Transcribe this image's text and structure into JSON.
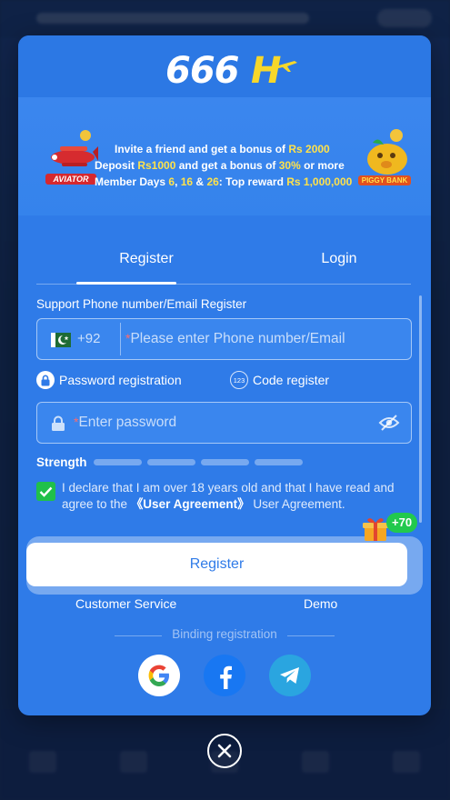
{
  "brand": {
    "logo_text": "666",
    "logo_letter": "H"
  },
  "promo": {
    "line1": {
      "text": "Invite a friend and get a bonus of ",
      "highlight": "Rs 2000"
    },
    "line2": {
      "pre": "Deposit ",
      "amount": "Rs1000",
      "mid": " and get a bonus of ",
      "percent": "30%",
      "post": " or more"
    },
    "line3": {
      "pre": "Member Days ",
      "d1": "6",
      "sep1": ", ",
      "d2": "16",
      "sep2": " & ",
      "d3": "26",
      "mid": ": Top reward ",
      "reward": "Rs 1,000,000"
    },
    "left_badge": "AVIATOR",
    "right_badge": "PIGGY BANK"
  },
  "tabs": {
    "register": "Register",
    "login": "Login",
    "active": "register"
  },
  "form": {
    "section_label": "Support Phone number/Email Register",
    "country_code": "+92",
    "phone_placeholder": "Please enter Phone number/Email",
    "password_placeholder": "Enter password",
    "required_mark": "*",
    "mode_password": "Password registration",
    "mode_code": "Code register",
    "code_icon_text": "123",
    "strength_label": "Strength",
    "strength_bars": 4,
    "strength_level": 0,
    "agree_text_1": "I declare that I am over 18 years old and that I have read and agree to the ",
    "agree_link": "《User Agreement》",
    "agree_text_2": " User Agreement.",
    "agree_checked": true,
    "register_button": "Register",
    "bonus_badge": "+70"
  },
  "links": {
    "customer_service": "Customer Service",
    "demo": "Demo"
  },
  "binding": {
    "label": "Binding registration",
    "providers": [
      "google",
      "facebook",
      "telegram"
    ]
  },
  "colors": {
    "modal_bg": "#2f7be8",
    "highlight": "#ffe24a",
    "check_green": "#20c04a"
  }
}
